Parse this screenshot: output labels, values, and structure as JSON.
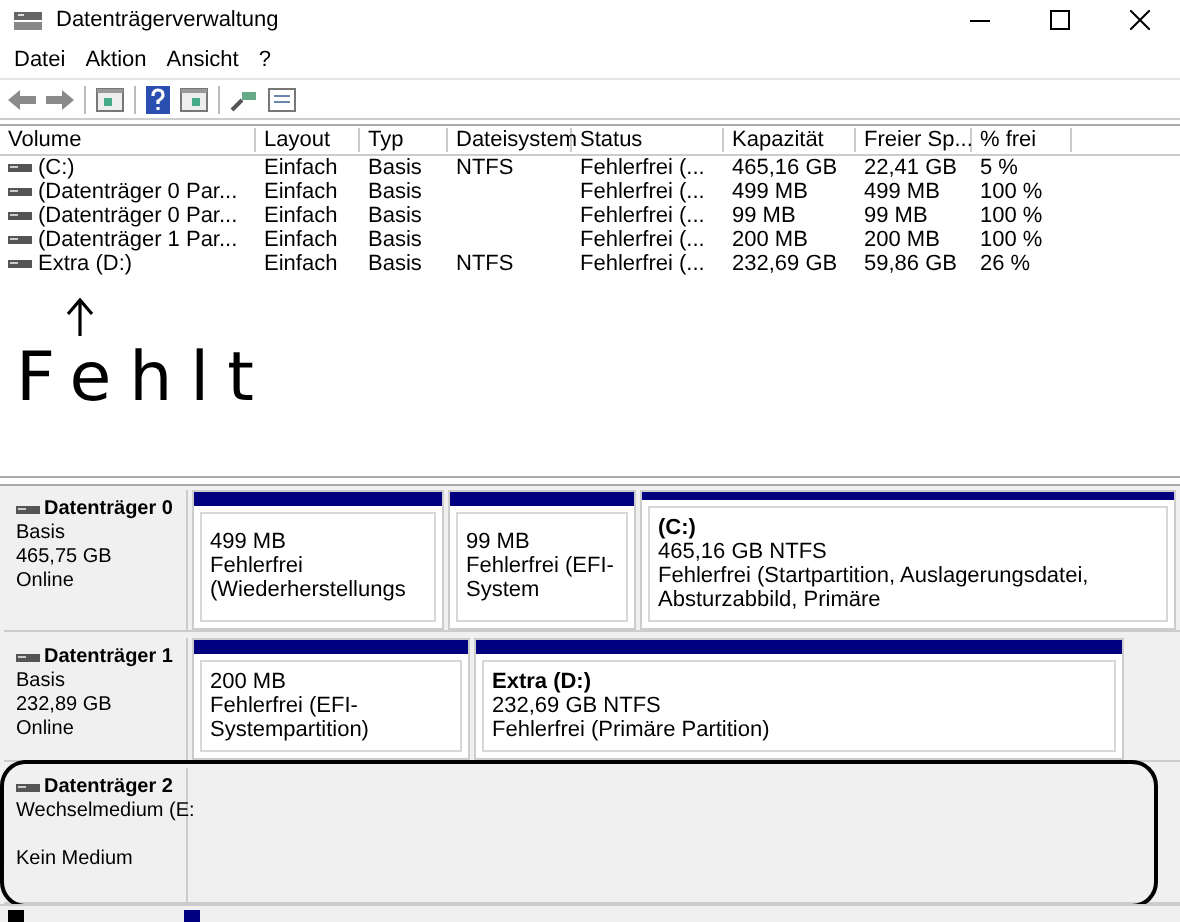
{
  "window": {
    "title": "Datenträgerverwaltung"
  },
  "menu": [
    "Datei",
    "Aktion",
    "Ansicht",
    "?"
  ],
  "volume_table": {
    "columns": [
      "Volume",
      "Layout",
      "Typ",
      "Dateisystem",
      "Status",
      "Kapazität",
      "Freier Sp...",
      "% frei"
    ],
    "rows": [
      {
        "cells": [
          "(C:)",
          "Einfach",
          "Basis",
          "NTFS",
          "Fehlerfrei (...",
          "465,16 GB",
          "22,41 GB",
          "5 %"
        ]
      },
      {
        "cells": [
          "(Datenträger 0 Par...",
          "Einfach",
          "Basis",
          "",
          "Fehlerfrei (...",
          "499 MB",
          "499 MB",
          "100 %"
        ]
      },
      {
        "cells": [
          "(Datenträger 0 Par...",
          "Einfach",
          "Basis",
          "",
          "Fehlerfrei (...",
          "99 MB",
          "99 MB",
          "100 %"
        ]
      },
      {
        "cells": [
          "(Datenträger 1 Par...",
          "Einfach",
          "Basis",
          "",
          "Fehlerfrei (...",
          "200 MB",
          "200 MB",
          "100 %"
        ]
      },
      {
        "cells": [
          "Extra (D:)",
          "Einfach",
          "Basis",
          "NTFS",
          "Fehlerfrei (...",
          "232,69 GB",
          "59,86 GB",
          "26 %"
        ]
      }
    ]
  },
  "annotation": {
    "text": "Fehlt"
  },
  "disks": [
    {
      "name": "Datenträger 0",
      "type": "Basis",
      "size": "465,75 GB",
      "status": "Online",
      "partitions": [
        {
          "size": "499 MB",
          "status": "Fehlerfrei (Wiederherstellungs"
        },
        {
          "size": "99 MB",
          "status": "Fehlerfrei (EFI-System"
        },
        {
          "title": "(C:)",
          "size": "465,16 GB NTFS",
          "status": "Fehlerfrei (Startpartition, Auslagerungsdatei, Absturzabbild, Primäre"
        }
      ]
    },
    {
      "name": "Datenträger 1",
      "type": "Basis",
      "size": "232,89 GB",
      "status": "Online",
      "partitions": [
        {
          "size": "200 MB",
          "status": "Fehlerfrei (EFI-Systempartition)"
        },
        {
          "title": "Extra  (D:)",
          "size": "232,69 GB NTFS",
          "status": "Fehlerfrei (Primäre Partition)"
        }
      ]
    },
    {
      "name": "Datenträger 2",
      "type": "Wechselmedium (E:",
      "status": "Kein Medium"
    }
  ]
}
